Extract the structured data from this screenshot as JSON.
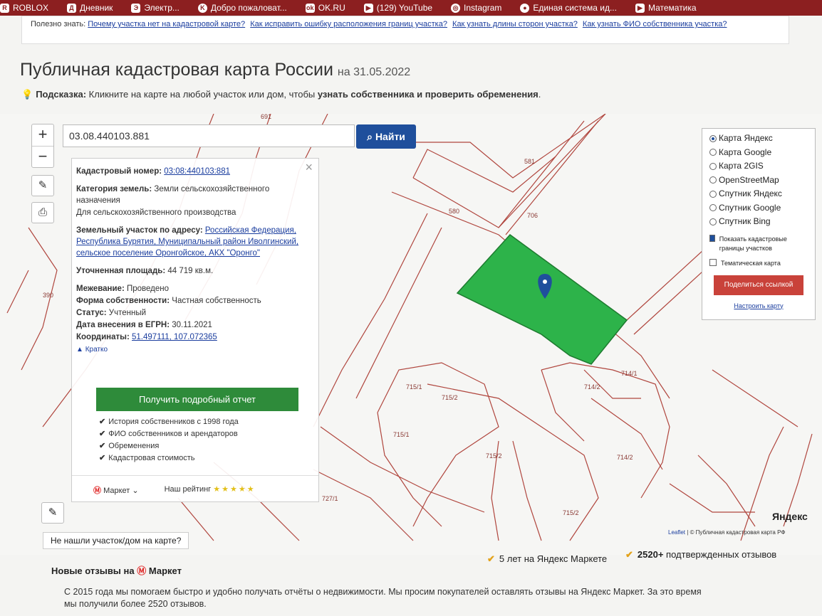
{
  "bookmarks": [
    {
      "label": "ROBLOX",
      "icon": "roblox-icon"
    },
    {
      "label": "Дневник",
      "icon": "diary-icon"
    },
    {
      "label": "Электр...",
      "icon": "bolt-icon"
    },
    {
      "label": "Добро пожаловат...",
      "icon": "vk-icon"
    },
    {
      "label": "OK.RU",
      "icon": "ok-icon"
    },
    {
      "label": "(129) YouTube",
      "icon": "youtube-icon"
    },
    {
      "label": "Instagram",
      "icon": "instagram-icon"
    },
    {
      "label": "Единая система ид...",
      "icon": "gov-icon"
    },
    {
      "label": "Математика",
      "icon": "math-icon"
    }
  ],
  "tips": {
    "prefix": "Полезно знать:",
    "links": [
      "Почему участка нет на кадастровой карте?",
      "Как исправить ошибку расположения границ участка?",
      "Как узнать длины сторон участка?",
      "Как узнать ФИО собственника участка?"
    ]
  },
  "page": {
    "title": "Публичная кадастровая карта России",
    "date": "на 31.05.2022",
    "hint_label": "Подсказка:",
    "hint_text": "Кликните на карте на любой участок или дом, чтобы",
    "hint_bold": "узнать собственника и проверить обременения"
  },
  "search": {
    "value": "03.08.440103.881",
    "button": "Найти"
  },
  "controls": {
    "zoom_in": "+",
    "zoom_out": "−"
  },
  "info": {
    "cad_label": "Кадастровый номер:",
    "cad_value": "03:08:440103:881",
    "cat_label": "Категория земель:",
    "cat_value": "Земли сельскохозяйственного назначения",
    "use_value": "Для сельскохозяйственного производства",
    "addr_label": "Земельный участок по адресу:",
    "addr_value": "Российская Федерация, Республика Бурятия, Муниципальный район Иволгинский, сельское поселение Оронгойское, АКХ \"Оронго\"",
    "area_label": "Уточненная площадь:",
    "area_value": "44 719 кв.м.",
    "survey_label": "Межевание:",
    "survey_value": "Проведено",
    "own_label": "Форма собственности:",
    "own_value": "Частная собственность",
    "status_label": "Статус:",
    "status_value": "Учтенный",
    "egrn_label": "Дата внесения в ЕГРН:",
    "egrn_value": "30.11.2021",
    "coord_label": "Координаты:",
    "coord_value": "51.497111, 107.072365",
    "short": "Кратко",
    "report_button": "Получить подробный отчет",
    "bullets": [
      "История собственников с 1998 года",
      "ФИО собственников и арендаторов",
      "Обременения",
      "Кадастровая стоимость"
    ],
    "market": "Маркет",
    "rating_label": "Наш рейтинг",
    "rating": 5
  },
  "layers": {
    "options": [
      "Карта Яндекс",
      "Карта Google",
      "Карта 2GIS",
      "OpenStreetMap",
      "Спутник Яндекс",
      "Спутник Google",
      "Спутник Bing"
    ],
    "selected": 0,
    "show_borders": "Показать кадастровые границы участков",
    "thematic": "Тематическая карта",
    "share": "Поделиться ссылкой",
    "configure": "Настроить карту"
  },
  "parcel_labels": [
    "691",
    "581",
    "580",
    "706",
    "390",
    "715/1",
    "715/2",
    "715/1",
    "715/2",
    "714/1",
    "714/2",
    "714/2",
    "727/1",
    "715/2"
  ],
  "map_footer": {
    "not_found": "Не нашли участок/дом на карте?",
    "yandex": "Яндекс",
    "attr_leaflet": "Leaflet",
    "attr_text": "© Публичная кадастровая карта РФ",
    "stat1": "5 лет на Яндекс Маркете",
    "stat2_num": "2520+",
    "stat2_text": "подтвержденных отзывов"
  },
  "reviews": {
    "title": "Новые отзывы на",
    "market": "Маркет"
  },
  "paragraph": "С 2015 года мы помогаем быстро и удобно получать отчёты о недвижимости. Мы просим покупателей оставлять отзывы на Яндекс Маркет. За это время мы получили более 2520 отзывов."
}
